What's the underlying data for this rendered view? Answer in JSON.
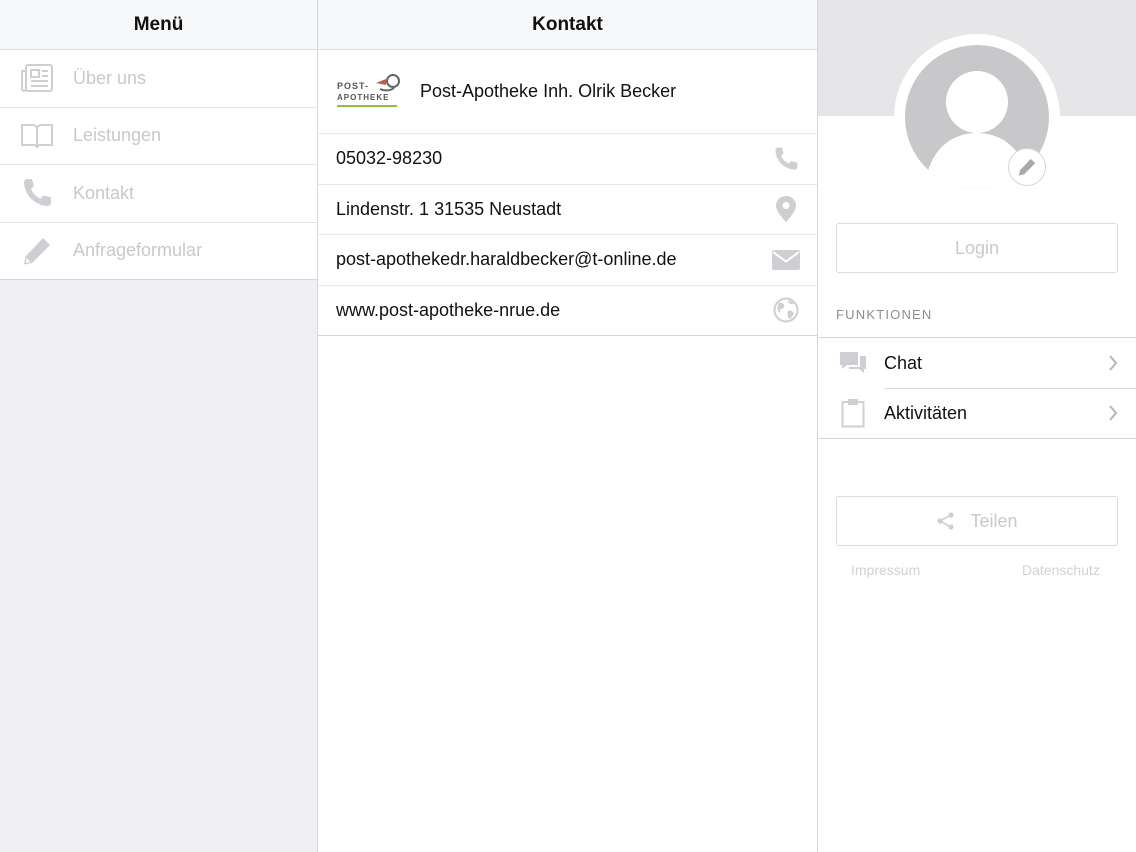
{
  "menu": {
    "title": "Menü",
    "items": [
      {
        "label": "Über uns",
        "icon": "newspaper-icon"
      },
      {
        "label": "Leistungen",
        "icon": "book-icon"
      },
      {
        "label": "Kontakt",
        "icon": "phone-icon"
      },
      {
        "label": "Anfrageformular",
        "icon": "pencil-icon"
      }
    ]
  },
  "contact": {
    "title": "Kontakt",
    "company": {
      "name": "Post-Apotheke Inh. Olrik Becker",
      "logo_text_top": "POST-",
      "logo_text_bottom": "APOTHEKE"
    },
    "rows": [
      {
        "text": "05032-98230",
        "icon": "phone-icon"
      },
      {
        "text": "Lindenstr. 1 31535 Neustadt",
        "icon": "map-pin-icon"
      },
      {
        "text": "post-apothekedr.haraldbecker@t-online.de",
        "icon": "mail-icon"
      },
      {
        "text": "www.post-apotheke-nrue.de",
        "icon": "globe-icon"
      }
    ]
  },
  "profile": {
    "login_label": "Login",
    "section_title": "FUNKTIONEN",
    "functions": [
      {
        "label": "Chat",
        "icon": "chat-bubbles-icon"
      },
      {
        "label": "Aktivitäten",
        "icon": "clipboard-icon"
      }
    ],
    "share_label": "Teilen",
    "footer": {
      "impressum": "Impressum",
      "datenschutz": "Datenschutz"
    }
  },
  "colors": {
    "menu_bg": "#f0eff4",
    "header_bg": "#f7f8f9",
    "disabled_text": "#c9c9cd",
    "divider": "#d7d7db",
    "avatar": "#c8c8cb",
    "logo_green": "#8fbf4a"
  }
}
